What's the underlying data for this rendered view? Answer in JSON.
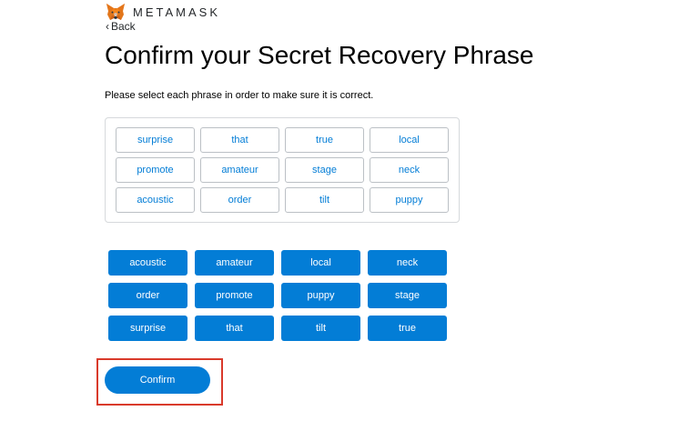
{
  "brand": {
    "name": "METAMASK",
    "logo_icon": "metamask-fox-icon"
  },
  "nav": {
    "back_label": "Back"
  },
  "page": {
    "title": "Confirm your Secret Recovery Phrase",
    "instruction": "Please select each phrase in order to make sure it is correct."
  },
  "selected_words": [
    "surprise",
    "that",
    "true",
    "local",
    "promote",
    "amateur",
    "stage",
    "neck",
    "acoustic",
    "order",
    "tilt",
    "puppy"
  ],
  "option_words": [
    "acoustic",
    "amateur",
    "local",
    "neck",
    "order",
    "promote",
    "puppy",
    "stage",
    "surprise",
    "that",
    "tilt",
    "true"
  ],
  "actions": {
    "confirm_label": "Confirm"
  },
  "colors": {
    "primary_blue": "#037dd6",
    "highlight_red": "#d93a2b",
    "border_gray": "#d6d9dc"
  }
}
